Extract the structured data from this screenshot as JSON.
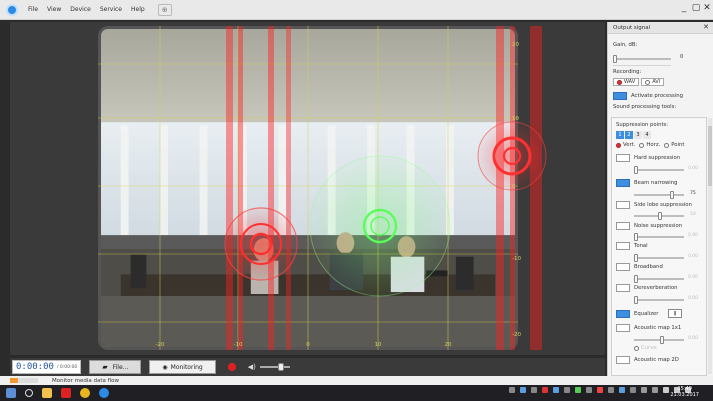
{
  "menu": {
    "items": [
      "File",
      "View",
      "Device",
      "Service",
      "Help"
    ],
    "window_controls": [
      "_",
      "▢",
      "✕"
    ]
  },
  "axes": {
    "x_ticks": [
      "-20",
      "-10",
      "0",
      "10",
      "20"
    ],
    "y_ticks": [
      "20",
      "10",
      "0",
      "-10",
      "-20"
    ]
  },
  "bottom": {
    "timecode": "0:00:00",
    "timecode_total": "/ 0:00:00",
    "file_label": "File...",
    "monitoring_label": "Monitoring"
  },
  "status": {
    "text": "Monitor media data flow",
    "progress_fraction": 0.3
  },
  "clock": {
    "time": "15:49",
    "date": "21.03.2017"
  },
  "panel": {
    "title": "Output signal",
    "gain_label": "Gain, dB:",
    "gain_value": "0",
    "recording_label": "Recording:",
    "rec_wav": "WAV",
    "rec_avi": "AVI",
    "activate_label": "Activate processing",
    "tools_label": "Sound processing tools:",
    "suppression_points_label": "Suppression points:",
    "points": [
      "1",
      "2",
      "3",
      "4"
    ],
    "mode_vert": "Vert.",
    "mode_horz": "Horz.",
    "mode_point": "Point",
    "hard_label": "Hard suppression",
    "hard_value": "0.00",
    "beam_label": "Beam narrowing",
    "beam_value": "75",
    "sidelobe_label": "Side lobe suppression",
    "sidelobe_value": "50",
    "noise_label": "Noise suppression",
    "noise_value": "0.00",
    "tonal_label": "Tonal",
    "tonal_value": "0.00",
    "broadband_label": "Broadband",
    "broadband_value": "0.00",
    "dereverb_label": "Dereverberation",
    "dereverb_value": "0.00",
    "equalizer_label": "Equalizer",
    "acoustic1_label": "Acoustic map 1x1",
    "acoustic1_value": "0.00",
    "curve_label": "Curve",
    "acoustic2_label": "Acoustic map 2D"
  }
}
